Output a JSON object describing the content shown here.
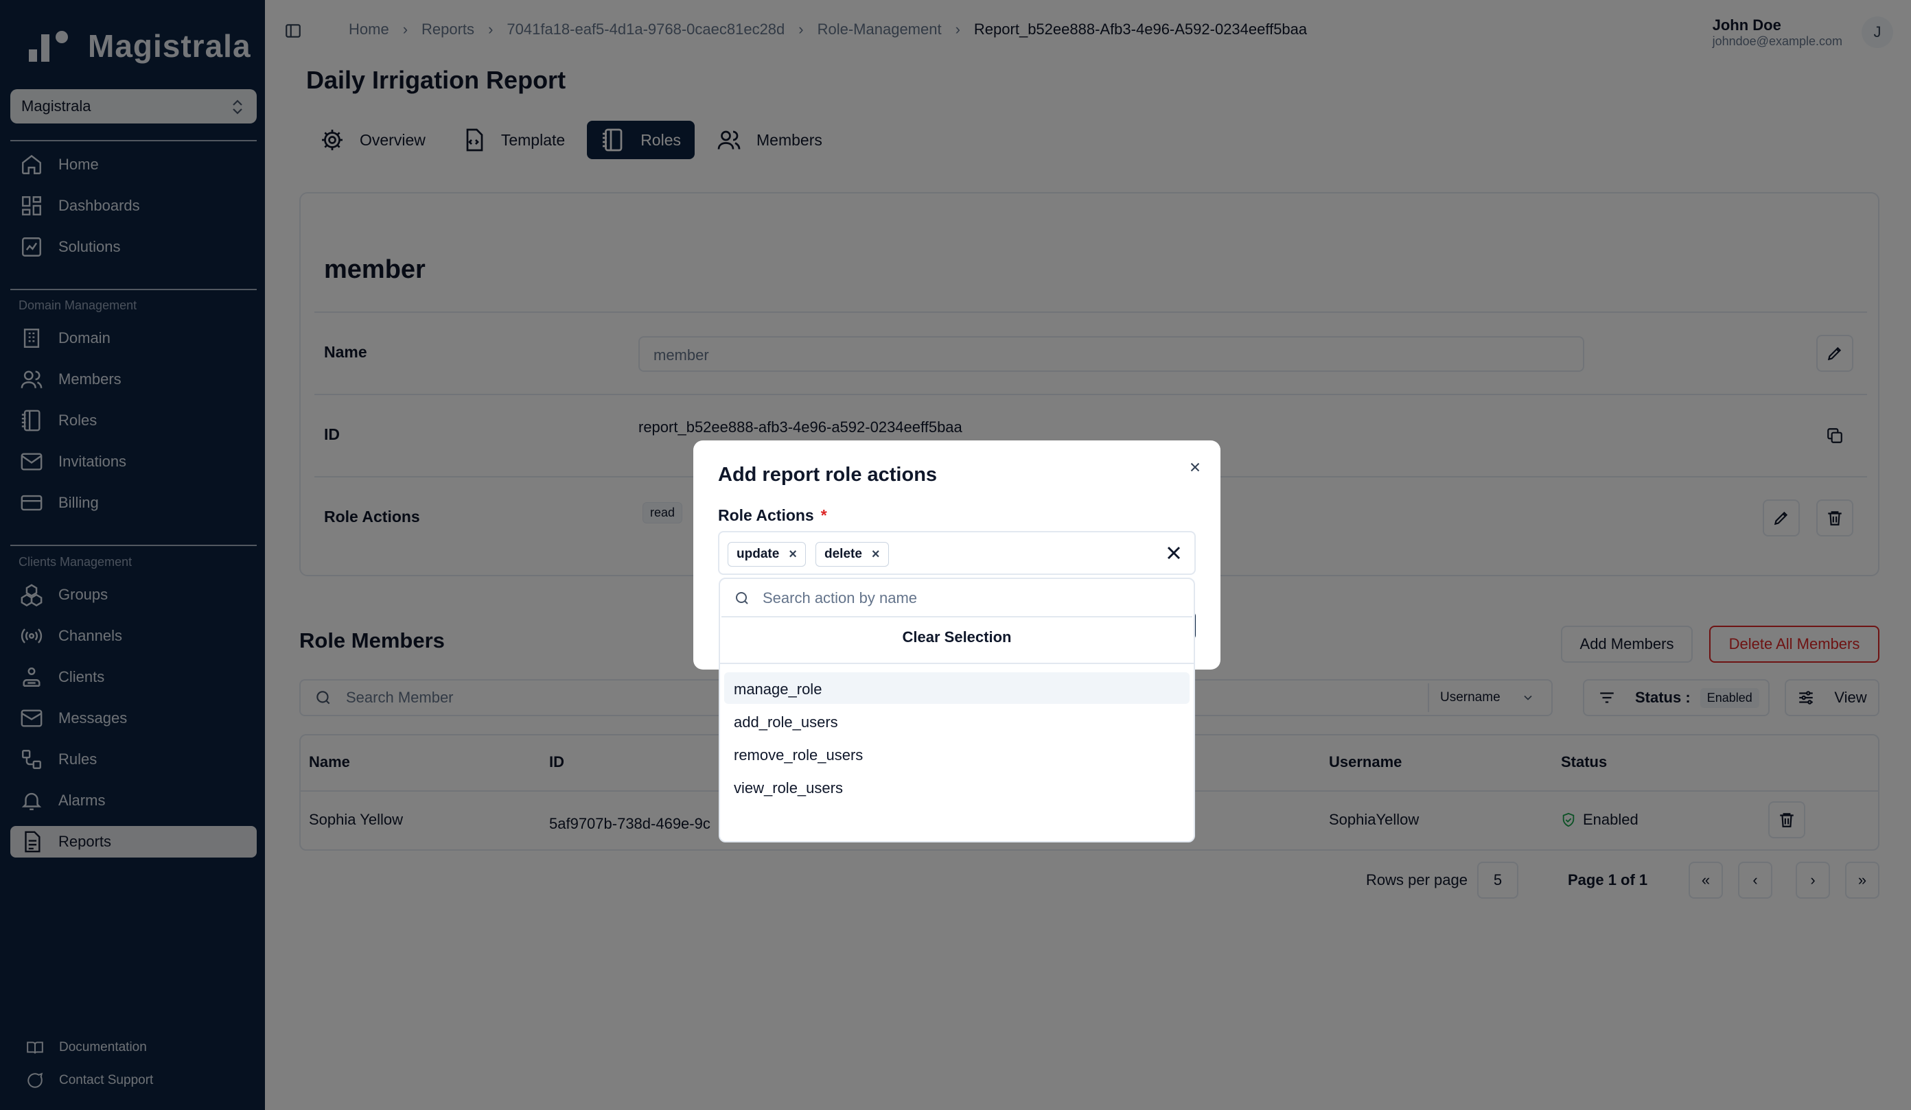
{
  "brand": {
    "name": "Magistrala"
  },
  "workspace": {
    "selected": "Magistrala"
  },
  "sidebar": {
    "main_items": [
      {
        "label": "Home",
        "icon": "home-icon"
      },
      {
        "label": "Dashboards",
        "icon": "dashboard-icon"
      },
      {
        "label": "Solutions",
        "icon": "solutions-icon"
      }
    ],
    "domain_group_label": "Domain Management",
    "domain_items": [
      {
        "label": "Domain",
        "icon": "building-icon"
      },
      {
        "label": "Members",
        "icon": "users-icon"
      },
      {
        "label": "Roles",
        "icon": "notebook-icon"
      },
      {
        "label": "Invitations",
        "icon": "mail-icon"
      },
      {
        "label": "Billing",
        "icon": "credit-card-icon"
      }
    ],
    "clients_group_label": "Clients Management",
    "clients_items": [
      {
        "label": "Groups",
        "icon": "boxes-icon"
      },
      {
        "label": "Channels",
        "icon": "radio-icon"
      },
      {
        "label": "Clients",
        "icon": "cpu-icon"
      },
      {
        "label": "Messages",
        "icon": "message-icon"
      },
      {
        "label": "Rules",
        "icon": "workflow-icon"
      },
      {
        "label": "Alarms",
        "icon": "bell-icon"
      },
      {
        "label": "Reports",
        "icon": "report-icon",
        "active": true
      }
    ],
    "footer_items": [
      {
        "label": "Documentation",
        "icon": "book-icon"
      },
      {
        "label": "Contact Support",
        "icon": "chat-icon"
      }
    ]
  },
  "breadcrumbs": [
    "Home",
    "Reports",
    "7041fa18-eaf5-4d1a-9768-0caec81ec28d",
    "Role-Management",
    "Report_b52ee888-Afb3-4e96-A592-0234eeff5baa"
  ],
  "user": {
    "name": "John Doe",
    "email": "johndoe@example.com",
    "initial": "J"
  },
  "page": {
    "title": "Daily Irrigation Report"
  },
  "tabs": [
    {
      "label": "Overview",
      "icon": "gear-icon"
    },
    {
      "label": "Template",
      "icon": "file-code-icon"
    },
    {
      "label": "Roles",
      "icon": "notebook-icon",
      "active": true
    },
    {
      "label": "Members",
      "icon": "users-icon"
    }
  ],
  "role": {
    "heading": "member",
    "name_label": "Name",
    "name_value": "member",
    "id_label": "ID",
    "id_value": "report_b52ee888-afb3-4e96-a592-0234eeff5baa",
    "actions_label": "Role Actions",
    "actions": [
      "read"
    ]
  },
  "members_section": {
    "title": "Role Members",
    "add_button": "Add Members",
    "delete_all_button": "Delete All Members",
    "search_placeholder": "Search Member",
    "search_field": "Username",
    "status_filter_label": "Status :",
    "status_filter_value": "Enabled",
    "view_button": "View",
    "columns": [
      "Name",
      "ID",
      "Username",
      "Status"
    ],
    "rows": [
      {
        "name": "Sophia Yellow",
        "id": "5af9707b-738d-469e-9c",
        "username": "SophiaYellow",
        "status": "Enabled"
      }
    ],
    "rows_per_page_label": "Rows per page",
    "rows_per_page": "5",
    "page_info": "Page 1 of 1"
  },
  "dialog": {
    "title": "Add report role actions",
    "field_label": "Role Actions",
    "required_mark": "*",
    "selected_tags": [
      "update",
      "delete"
    ],
    "search_placeholder": "Search action by name",
    "clear_label": "Clear Selection",
    "options": [
      "manage_role",
      "add_role_users",
      "remove_role_users",
      "view_role_users"
    ]
  },
  "colors": {
    "sidebar_bg": "#0c2340",
    "accent": "#0c2340",
    "danger": "#dc2626",
    "success": "#16a34a"
  }
}
